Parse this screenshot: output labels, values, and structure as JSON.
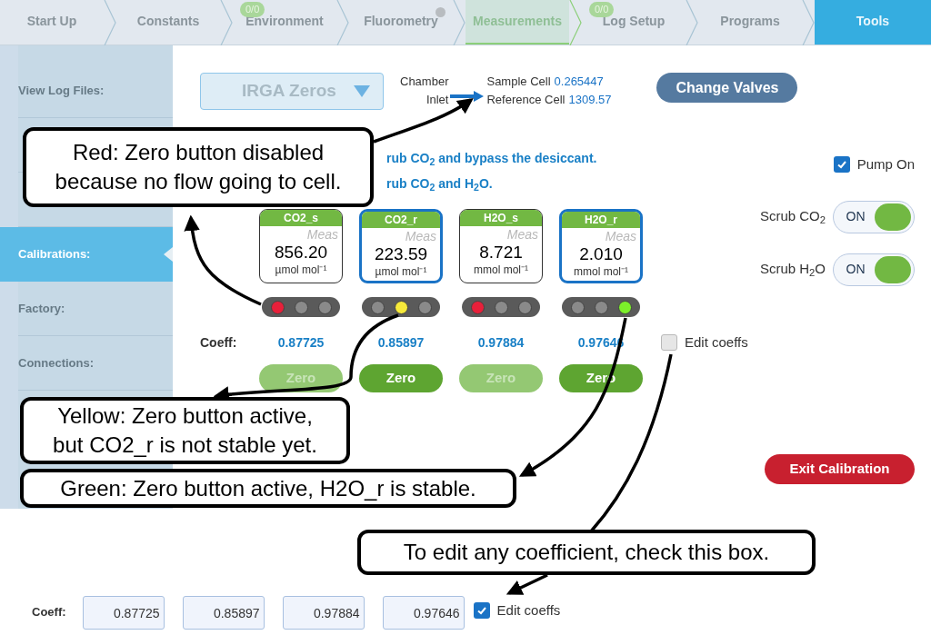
{
  "nav_tabs": [
    {
      "label": "Start Up",
      "selected": false,
      "highlighted": false,
      "dot": false
    },
    {
      "label": "Constants",
      "selected": false,
      "highlighted": false,
      "dot": false
    },
    {
      "label": "Environment",
      "selected": false,
      "highlighted": false,
      "badge": "0/0",
      "dot": false
    },
    {
      "label": "Fluorometry",
      "selected": false,
      "highlighted": false,
      "dot": true
    },
    {
      "label": "Measurements",
      "selected": false,
      "highlighted": true,
      "dot": false
    },
    {
      "label": "Log Setup",
      "selected": false,
      "highlighted": false,
      "badge": "0/0",
      "dot": false
    },
    {
      "label": "Programs",
      "selected": false,
      "highlighted": false,
      "dot": false
    },
    {
      "label": "Tools",
      "selected": true,
      "highlighted": false,
      "dot": false
    }
  ],
  "sidebar": {
    "items": [
      {
        "label": "View Log Files:",
        "selected": false
      },
      {
        "selected": false
      },
      {
        "selected": false
      },
      {
        "label": "Calibrations:",
        "selected": true
      },
      {
        "label": "Factory:",
        "selected": false
      },
      {
        "label": "Connections:",
        "selected": false
      }
    ]
  },
  "mode_dropdown": {
    "value": "IRGA Zeros"
  },
  "flow": {
    "chamber": "Chamber",
    "inlet": "Inlet",
    "rows": [
      {
        "label": "Sample Cell",
        "value": "0.265447"
      },
      {
        "label": "Reference Cell",
        "value": "1309.57"
      }
    ]
  },
  "change_valves_button": "Change Valves",
  "instructions": [
    "rub CO$_{2}$ and bypass the desiccant.",
    "rub CO$_{2}$ and H$_{2}$O."
  ],
  "pump": {
    "label": "Pump On",
    "checked": true
  },
  "scrubs": [
    {
      "label": "Scrub CO$_{2}$",
      "state": "ON",
      "on": true
    },
    {
      "label": "Scrub H$_{2}$O",
      "state": "ON",
      "on": true
    }
  ],
  "sensors": [
    {
      "name": "CO2_s",
      "mode": "Meas",
      "value": "856.20",
      "unit": "µmol mol⁻¹",
      "selected": false,
      "lights": [
        {
          "color": "#e8203a"
        },
        {
          "color": "#8a8a8a"
        },
        {
          "color": "#8a8a8a"
        }
      ],
      "coeff": "0.87725",
      "zero": {
        "label": "Zero",
        "disabled": true
      }
    },
    {
      "name": "CO2_r",
      "mode": "Meas",
      "value": "223.59",
      "unit": "µmol mol⁻¹",
      "selected": true,
      "lights": [
        {
          "color": "#8a8a8a"
        },
        {
          "color": "#f7ea3a"
        },
        {
          "color": "#8a8a8a"
        }
      ],
      "coeff": "0.85897",
      "zero": {
        "label": "Zero",
        "disabled": false
      }
    },
    {
      "name": "H2O_s",
      "mode": "Meas",
      "value": "8.721",
      "unit": "mmol mol⁻¹",
      "selected": false,
      "lights": [
        {
          "color": "#e8203a"
        },
        {
          "color": "#8a8a8a"
        },
        {
          "color": "#8a8a8a"
        }
      ],
      "coeff": "0.97884",
      "zero": {
        "label": "Zero",
        "disabled": true
      }
    },
    {
      "name": "H2O_r",
      "mode": "Meas",
      "value": "2.010",
      "unit": "mmol mol⁻¹",
      "selected": true,
      "lights": [
        {
          "color": "#8a8a8a"
        },
        {
          "color": "#8a8a8a"
        },
        {
          "color": "#7cf02a"
        }
      ],
      "coeff": "0.97646",
      "zero": {
        "label": "Zero",
        "disabled": false
      }
    }
  ],
  "coeff_label": "Coeff:",
  "edit_coeffs": {
    "label": "Edit coeffs",
    "checked": false
  },
  "exit_button": "Exit Calibration",
  "bottom": {
    "coeff_label": "Coeff:",
    "inputs": [
      "0.87725",
      "0.85897",
      "0.97884",
      "0.97646"
    ],
    "edit_coeffs": {
      "label": "Edit coeffs",
      "checked": true
    }
  },
  "callouts": [
    {
      "lines": [
        "Red: Zero button disabled",
        "because no flow going to cell."
      ]
    },
    {
      "lines": [
        "Yellow: Zero button active,",
        "but CO2_r is not stable yet."
      ]
    },
    {
      "lines": [
        "Green: Zero button active, H2O_r is stable."
      ]
    },
    {
      "lines": [
        "To edit any coefficient, check this box."
      ]
    }
  ]
}
